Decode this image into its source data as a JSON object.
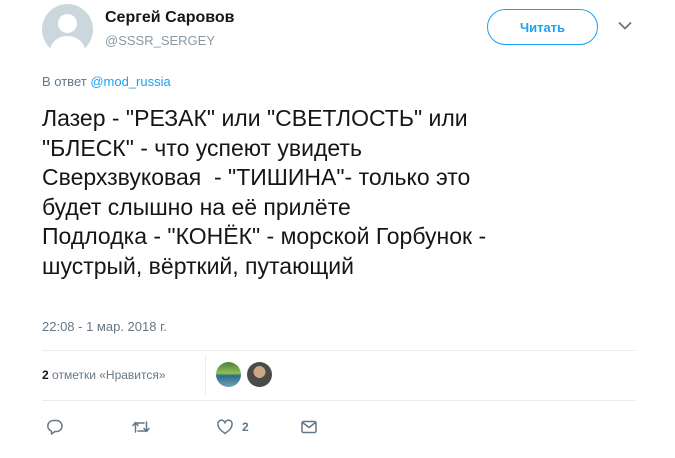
{
  "author": {
    "name": "Сергей Саровов",
    "handle": "@SSSR_SERGEY"
  },
  "header": {
    "follow_label": "Читать"
  },
  "reply_to": {
    "prefix": "В ответ",
    "mention": "@mod_russia"
  },
  "tweet": {
    "lines": [
      "Лазер - \"РЕЗАК\" или \"СВЕТЛОСТЬ\" или",
      "\"БЛЕСК\" - что успеют увидеть",
      "Сверхзвуковая  - \"ТИШИНА\"- только это",
      "будет слышно на её прилёте",
      "Подлодка - \"КОНЁК\" - морской Горбунок -",
      "шустрый, вёрткий, путающий"
    ],
    "timestamp": "22:08 - 1 мар. 2018 г."
  },
  "stats": {
    "likes_count": "2",
    "likes_label": "отметки «Нравится»"
  },
  "actions": {
    "like_count": "2"
  },
  "colors": {
    "accent": "#1da1f2",
    "secondary_text": "#657786",
    "divider": "#e6ecf0"
  },
  "icons": [
    "reply-icon",
    "retweet-icon",
    "heart-icon",
    "direct-message-icon",
    "chevron-down-icon"
  ]
}
